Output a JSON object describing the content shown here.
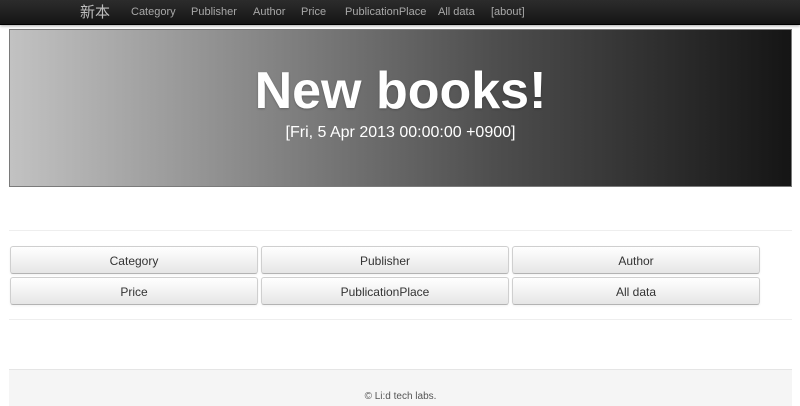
{
  "navbar": {
    "brand": "新本",
    "items": [
      "Category",
      "Publisher",
      "Author",
      "Price",
      "PublicationPlace",
      "All data",
      "[about]"
    ]
  },
  "hero": {
    "title": "New books!",
    "date": "[Fri, 5 Apr 2013 00:00:00 +0900]"
  },
  "buttons": {
    "row1": [
      "Category",
      "Publisher",
      "Author"
    ],
    "row2": [
      "Price",
      "PublicationPlace",
      "All data"
    ]
  },
  "footer": {
    "text": "© Li:d tech labs."
  },
  "colors": {
    "navbar": "#1b1b1b",
    "nav_text": "#a8a8a8",
    "hero_light": "#c2c2c2",
    "hero_dark": "#151515",
    "hero_text": "#ffffff",
    "button_bg": "#f0f0f0"
  }
}
